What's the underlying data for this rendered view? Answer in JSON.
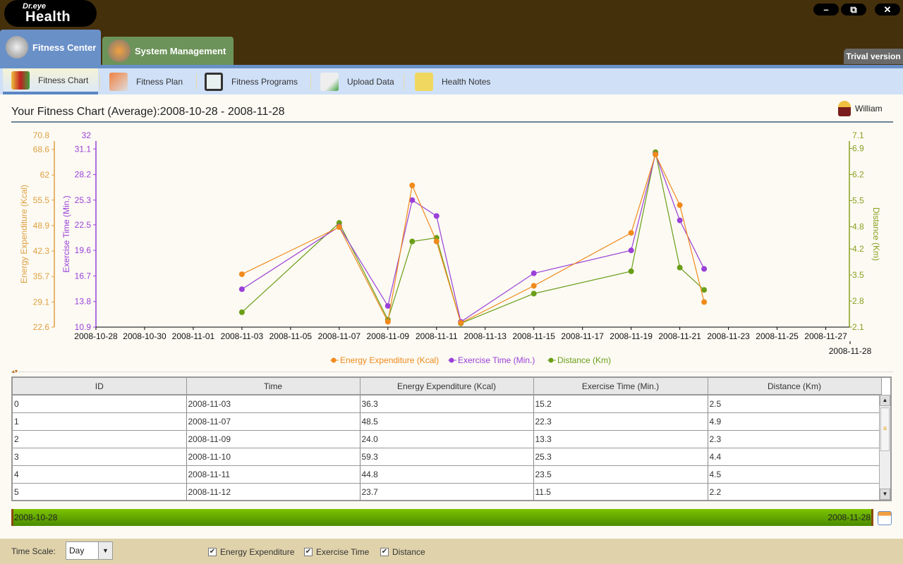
{
  "app": {
    "logo_top": "Dr.eye",
    "logo_main": "Health",
    "trial_badge": "Trival version",
    "window_controls": [
      "minimize-icon",
      "restore-icon",
      "close-icon"
    ]
  },
  "main_tabs": [
    {
      "label": "Fitness Center",
      "icon": "dumbbell-icon",
      "active": true
    },
    {
      "label": "System Management",
      "icon": "wrench-gear-icon",
      "active": false
    }
  ],
  "sub_nav": [
    {
      "label": "Fitness Chart",
      "icon": "bar-chart-icon",
      "active": true
    },
    {
      "label": "Fitness Plan",
      "icon": "flag-path-icon"
    },
    {
      "label": "Fitness Programs",
      "icon": "monitor-icon"
    },
    {
      "label": "Upload Data",
      "icon": "upload-document-icon"
    },
    {
      "label": "Health Notes",
      "icon": "note-icon"
    }
  ],
  "page": {
    "title": "Your Fitness Chart (Average):2008-10-28 - 2008-11-28",
    "user": "William"
  },
  "colors": {
    "energy": "#f08a1c",
    "time": "#9a40d8",
    "distance": "#6a9e18",
    "axis_energy": "#e0a040",
    "axis_distance": "#8aa020"
  },
  "chart_data": {
    "type": "line",
    "x_ticks": [
      "2008-10-28",
      "2008-10-30",
      "2008-11-01",
      "2008-11-03",
      "2008-11-05",
      "2008-11-07",
      "2008-11-09",
      "2008-11-11",
      "2008-11-13",
      "2008-11-15",
      "2008-11-17",
      "2008-11-19",
      "2008-11-21",
      "2008-11-23",
      "2008-11-25",
      "2008-11-27"
    ],
    "x_end_label": "2008-11-28",
    "xlim": [
      "2008-10-28",
      "2008-11-28"
    ],
    "x": [
      "2008-11-03",
      "2008-11-07",
      "2008-11-09",
      "2008-11-10",
      "2008-11-11",
      "2008-11-12",
      "2008-11-15",
      "2008-11-19",
      "2008-11-20",
      "2008-11-21",
      "2008-11-22"
    ],
    "axes": [
      {
        "label": "Energy Expenditure (Kcal)",
        "side": "left",
        "max_label": "70.8",
        "ylim": [
          22.6,
          70.8
        ],
        "ticks": [
          "22.6",
          "29.1",
          "35.7",
          "42.3",
          "48.9",
          "55.5",
          "62",
          "68.6"
        ]
      },
      {
        "label": "Exercise Time (Min.)",
        "side": "left",
        "max_label": "32",
        "ylim": [
          10.9,
          32
        ],
        "ticks": [
          "10.9",
          "13.8",
          "16.7",
          "19.6",
          "22.5",
          "25.3",
          "28.2",
          "31.1"
        ]
      },
      {
        "label": "Distance (Km)",
        "side": "right",
        "max_label": "7.1",
        "ylim": [
          2.1,
          7.1
        ],
        "ticks": [
          "2.1",
          "2.8",
          "3.5",
          "4.2",
          "4.8",
          "5.5",
          "6.2",
          "6.9"
        ]
      }
    ],
    "series": [
      {
        "name": "Energy Expenditure (Kcal)",
        "axis": 0,
        "values": [
          36.3,
          48.5,
          24.0,
          59.3,
          44.8,
          23.7,
          33.3,
          47.0,
          67.3,
          54.2,
          29.1
        ]
      },
      {
        "name": "Exercise Time (Min.)",
        "axis": 1,
        "values": [
          15.2,
          22.3,
          13.3,
          25.3,
          23.5,
          11.5,
          17.0,
          19.6,
          30.5,
          23.0,
          17.5
        ]
      },
      {
        "name": "Distance (Km)",
        "axis": 2,
        "values": [
          2.5,
          4.9,
          2.3,
          4.4,
          4.5,
          2.2,
          3.0,
          3.6,
          6.8,
          3.7,
          3.1
        ]
      }
    ],
    "legend": "bottom",
    "grid": false
  },
  "table": {
    "headers": [
      "ID",
      "Time",
      "Energy Expenditure (Kcal)",
      "Exercise Time (Min.)",
      "Distance (Km)"
    ],
    "rows": [
      [
        "0",
        "2008-11-03",
        "36.3",
        "15.2",
        "2.5"
      ],
      [
        "1",
        "2008-11-07",
        "48.5",
        "22.3",
        "4.9"
      ],
      [
        "2",
        "2008-11-09",
        "24.0",
        "13.3",
        "2.3"
      ],
      [
        "3",
        "2008-11-10",
        "59.3",
        "25.3",
        "4.4"
      ],
      [
        "4",
        "2008-11-11",
        "44.8",
        "23.5",
        "4.5"
      ],
      [
        "5",
        "2008-11-12",
        "23.7",
        "11.5",
        "2.2"
      ]
    ]
  },
  "range": {
    "start": "2008-10-28",
    "end": "2008-11-28"
  },
  "bottom": {
    "time_scale_label": "Time Scale:",
    "time_scale_value": "Day",
    "checks": [
      {
        "label": "Energy Expenditure",
        "checked": true
      },
      {
        "label": "Exercise Time",
        "checked": true
      },
      {
        "label": "Distance",
        "checked": true
      }
    ]
  }
}
